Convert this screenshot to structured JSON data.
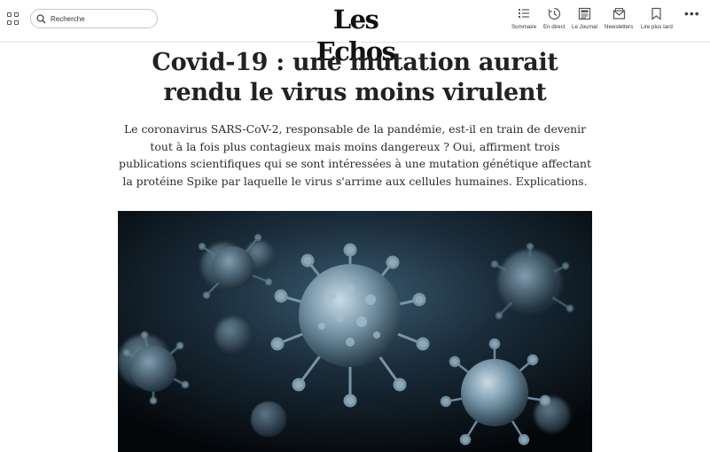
{
  "header": {
    "logo": "Les Echos",
    "search": {
      "placeholder": "Recherche"
    },
    "tools": [
      {
        "label": "Sommaire",
        "icon": "list-icon"
      },
      {
        "label": "En direct",
        "icon": "clock-icon"
      },
      {
        "label": "Le Journal",
        "icon": "newspaper-icon"
      },
      {
        "label": "Newsletters",
        "icon": "envelope-icon"
      },
      {
        "label": "Lire plus tard",
        "icon": "bookmark-icon"
      }
    ],
    "more_label": "⋮⋮"
  },
  "article": {
    "title": "Covid-19 : une mutation aurait rendu le virus moins virulent",
    "lead": "Le coronavirus SARS-CoV-2, responsable de la pandémie, est-il en train de devenir tout à la fois plus contagieux mais moins dangereux ? Oui, affirment trois publications scientifiques qui se sont intéressées à une mutation génétique affectant la protéine Spike par laquelle le virus s'arrime aux cellules humaines. Explications."
  }
}
